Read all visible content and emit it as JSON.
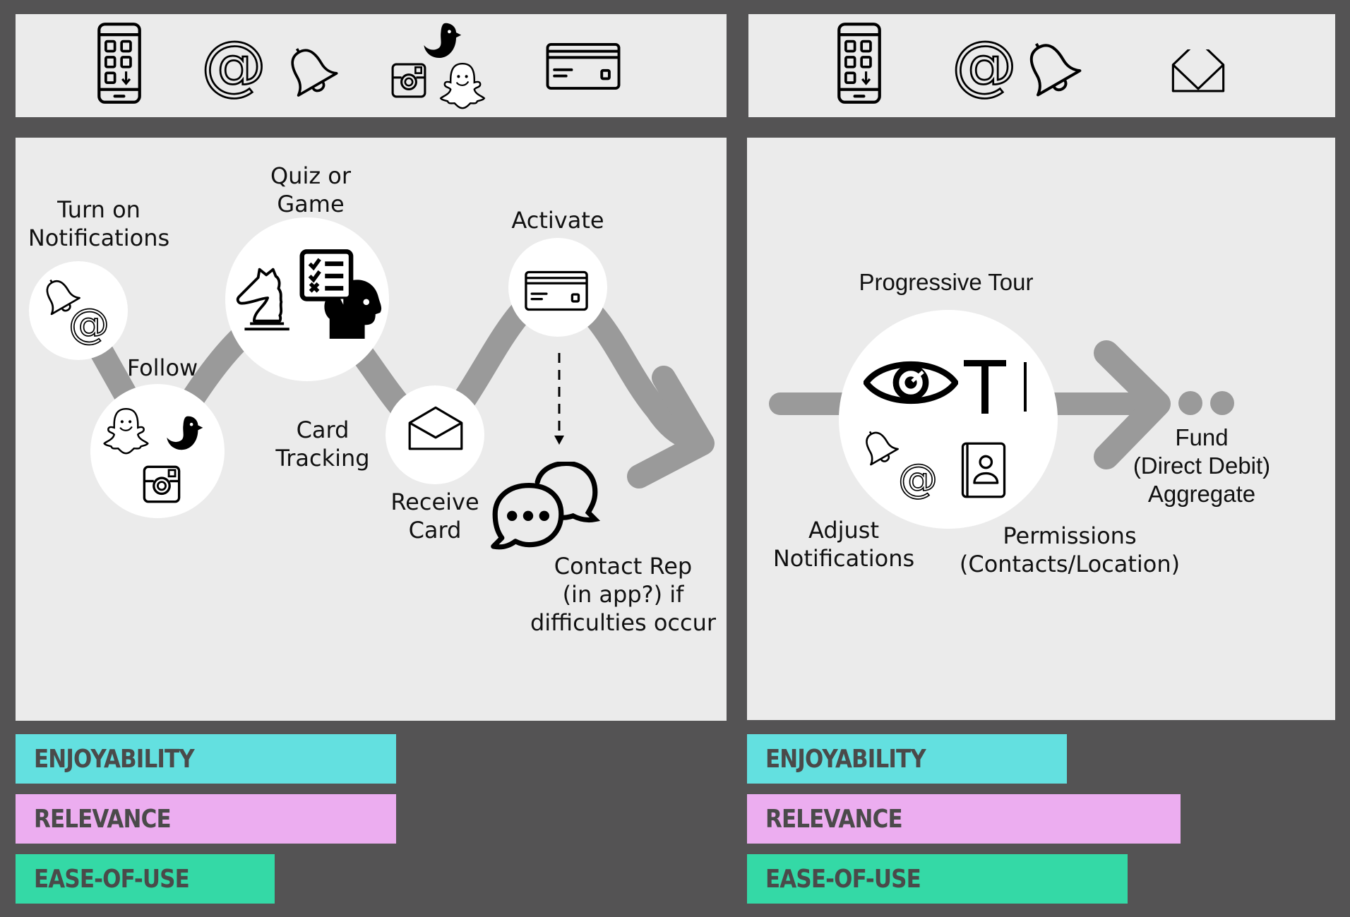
{
  "colors": {
    "background": "#545354",
    "panel": "#ebebeb",
    "path": "#9a9a9a",
    "enjoyability": "#63e0e0",
    "relevance": "#ecadf0",
    "ease_of_use": "#34d9a6",
    "bar_text": "#4a4a4a"
  },
  "left": {
    "header_icons": [
      "phone-apps-icon",
      "at-sign-icon",
      "bell-icon",
      "twitter-bird-icon",
      "instagram-icon",
      "snapchat-ghost-icon",
      "credit-card-icon"
    ],
    "steps": [
      {
        "id": "notifications",
        "label_line1": "Turn on",
        "label_line2": "Notifications",
        "icons": [
          "bell-icon",
          "at-sign-icon"
        ]
      },
      {
        "id": "follow",
        "label_line1": "Follow",
        "icons": [
          "snapchat-ghost-icon",
          "twitter-bird-icon",
          "instagram-icon"
        ]
      },
      {
        "id": "quiz",
        "label_line1": "Quiz or",
        "label_line2": "Game",
        "icons": [
          "chess-knight-icon",
          "quiz-checklist-head-icon"
        ]
      },
      {
        "id": "tracking",
        "label_line1": "Card",
        "label_line2": "Tracking"
      },
      {
        "id": "receive",
        "label_line1": "Receive",
        "label_line2": "Card",
        "icons": [
          "envelope-icon"
        ]
      },
      {
        "id": "activate",
        "label_line1": "Activate",
        "icons": [
          "credit-card-icon"
        ]
      },
      {
        "id": "contact",
        "label_line1": "Contact Rep",
        "label_line2": "(in app?) if",
        "label_line3": "difficulties occur",
        "icons": [
          "chat-bubbles-icon"
        ]
      }
    ],
    "scores": {
      "enjoyability": {
        "label": "ENJOYABILITY",
        "value": 1.0
      },
      "relevance": {
        "label": "RELEVANCE",
        "value": 1.0
      },
      "ease_of_use": {
        "label": "EASE-OF-USE",
        "value": 0.68
      }
    }
  },
  "right": {
    "header_icons": [
      "phone-apps-icon",
      "at-sign-icon",
      "bell-icon",
      "envelope-icon"
    ],
    "steps": [
      {
        "id": "tour",
        "label_line1": "Progressive Tour",
        "icons": [
          "eye-icon",
          "text-cursor-icon"
        ]
      },
      {
        "id": "adjust",
        "label_line1": "Adjust",
        "label_line2": "Notifications",
        "icons": [
          "bell-icon",
          "at-sign-icon"
        ]
      },
      {
        "id": "permissions",
        "label_line1": "Permissions",
        "label_line2": "(Contacts/Location)",
        "icons": [
          "contact-book-icon"
        ]
      },
      {
        "id": "fund",
        "label_line1": "Fund",
        "label_line2": "(Direct Debit)",
        "label_line3": "Aggregate"
      }
    ],
    "scores": {
      "enjoyability": {
        "label": "ENJOYABILITY",
        "value": 0.84
      },
      "relevance": {
        "label": "RELEVANCE",
        "value": 1.14
      },
      "ease_of_use": {
        "label": "EASE-OF-USE",
        "value": 1.0
      }
    }
  }
}
